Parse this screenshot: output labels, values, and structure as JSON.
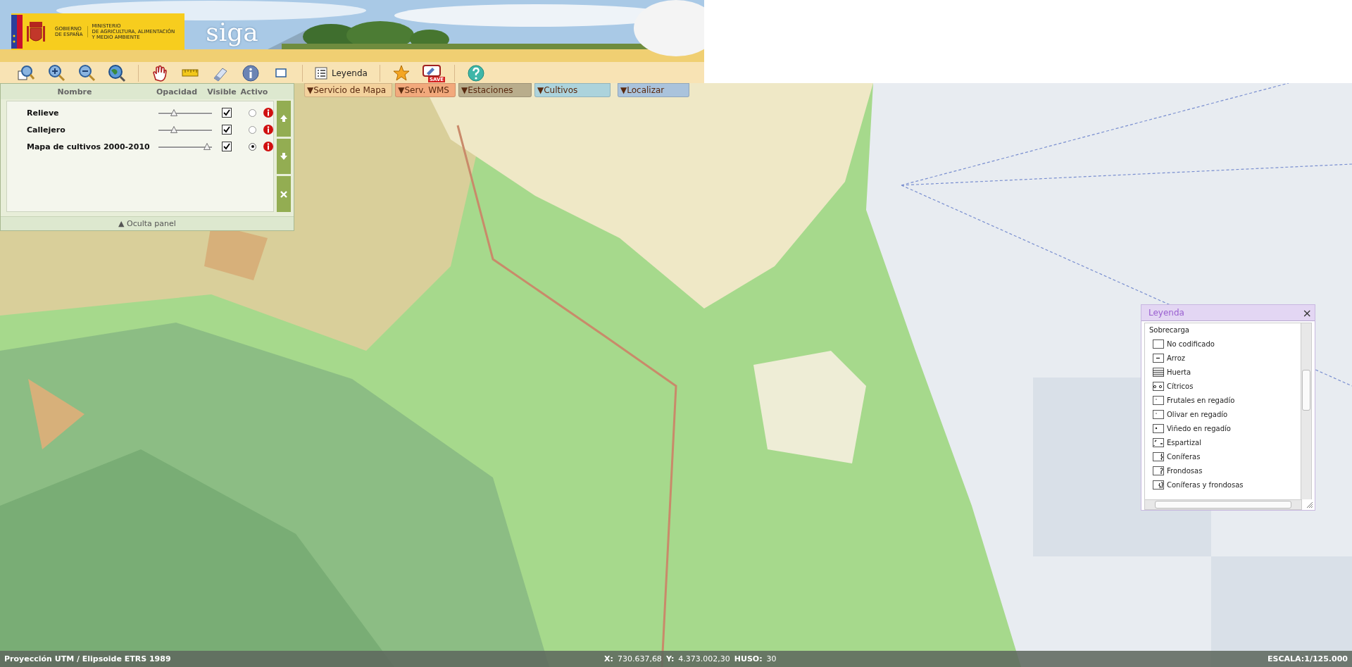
{
  "header": {
    "government_lines": [
      "GOBIERNO",
      "DE ESPAÑA"
    ],
    "ministry_lines": [
      "MINISTERIO",
      "DE AGRICULTURA, ALIMENTACIÓN",
      "Y MEDIO AMBIENTE"
    ],
    "app_name": "siga"
  },
  "toolbar": [
    {
      "kind": "zoom-box"
    },
    {
      "kind": "zoom-in"
    },
    {
      "kind": "zoom-out"
    },
    {
      "kind": "full-extent"
    },
    {
      "kind": "separator"
    },
    {
      "kind": "pan"
    },
    {
      "kind": "measure"
    },
    {
      "kind": "clear"
    },
    {
      "kind": "info"
    },
    {
      "kind": "select-rect"
    },
    {
      "kind": "separator"
    },
    {
      "kind": "legend",
      "label": "Leyenda"
    },
    {
      "kind": "separator"
    },
    {
      "kind": "favorite"
    },
    {
      "kind": "save",
      "label": "SAVE"
    },
    {
      "kind": "separator"
    },
    {
      "kind": "help"
    }
  ],
  "tabs": [
    {
      "arrow": "▼",
      "label": "Servicio de Mapa",
      "color": "#f3d19c"
    },
    {
      "arrow": "▼",
      "label": "Serv. WMS",
      "color": "#f2a97c"
    },
    {
      "arrow": "▼",
      "label": "Estaciones",
      "color": "#b9ad8c"
    },
    {
      "arrow": "▼",
      "label": "Cultivos",
      "color": "#acd3dc"
    },
    {
      "arrow": "▼",
      "label": "Localizar",
      "color": "#aac3dc"
    }
  ],
  "layer_panel": {
    "columns": [
      "Nombre",
      "Opacidad",
      "Visible",
      "Activo"
    ],
    "layers": [
      {
        "name": "Relieve",
        "level": 0.25,
        "visible": true,
        "selected": false
      },
      {
        "name": "Callejero",
        "level": 0.25,
        "visible": true,
        "selected": false
      },
      {
        "name": "Mapa de cultivos 2000-2010",
        "level": 0.97,
        "visible": true,
        "selected": true
      }
    ],
    "buttons": [
      {
        "kind": "up"
      },
      {
        "kind": "down"
      },
      {
        "kind": "close"
      }
    ],
    "footer": {
      "arrow": "▲",
      "label": "Oculta panel"
    }
  },
  "legend": {
    "title": "Leyenda",
    "close": "×",
    "group": "Sobrecarga",
    "items": [
      {
        "label": "No codificado",
        "kind": "empty"
      },
      {
        "label": "Arroz",
        "kind": "dash"
      },
      {
        "label": "Huerta",
        "kind": "lines"
      },
      {
        "label": "Cítricos",
        "kind": "circles"
      },
      {
        "label": "Frutales en regadío",
        "kind": "dot"
      },
      {
        "label": "Olivar en regadío",
        "kind": "dot"
      },
      {
        "label": "Viñedo en regadío",
        "kind": "big-dot"
      },
      {
        "label": "Espartizal",
        "kind": "ticks"
      },
      {
        "label": "Coníferas",
        "kind": "conifer"
      },
      {
        "label": "Frondosas",
        "kind": "broadleaf"
      },
      {
        "label": "Coníferas y frondosas",
        "kind": "mixed"
      }
    ]
  },
  "status_bar": {
    "projection": "Proyección UTM / Elipsoide ETRS 1989",
    "x_label": "X:",
    "x_value": "730.637,68",
    "y_label": "Y:",
    "y_value": "4.373.002,30",
    "zone_label": "HUSO:",
    "zone_value": "30",
    "scale": "ESCALA:1/125.000"
  }
}
